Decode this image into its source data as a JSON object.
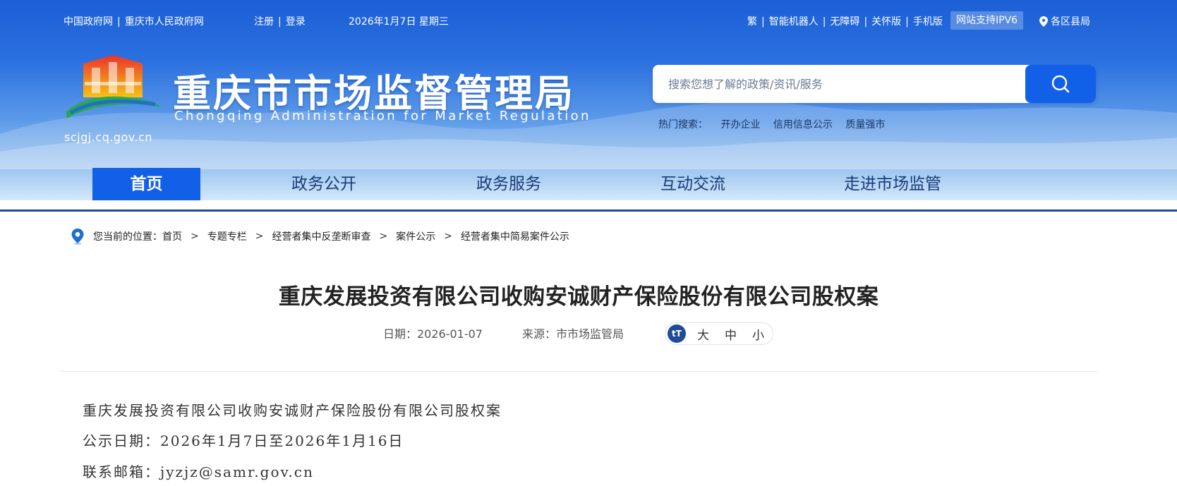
{
  "topbar": {
    "links": [
      "中国政府网",
      "重庆市人民政府网"
    ],
    "auth": [
      "注册",
      "登录"
    ],
    "date": "2026年1月7日 星期三",
    "tools": [
      "繁",
      "智能机器人",
      "无障碍",
      "关怀版",
      "手机版"
    ],
    "ipv6": "网站支持IPV6",
    "region": "各区县局"
  },
  "branding": {
    "title": "重庆市市场监督管理局",
    "subtitle": "Chongqing Administration for Market Regulation",
    "domain": "scjgj.cq.gov.cn"
  },
  "search": {
    "placeholder": "搜索您想了解的政策/资讯/服务",
    "hot_label": "热门搜索：",
    "hot_terms": [
      "开办企业",
      "信用信息公示",
      "质量强市"
    ]
  },
  "nav": [
    "首页",
    "政务公开",
    "政务服务",
    "互动交流",
    "走进市场监管"
  ],
  "breadcrumb": {
    "label": "您当前的位置：",
    "items": [
      "首页",
      "专题专栏",
      "经营者集中反垄断审查",
      "案件公示",
      "经营者集中简易案件公示"
    ],
    "separator": ">"
  },
  "article": {
    "title": "重庆发展投资有限公司收购安诚财产保险股份有限公司股权案",
    "date": "日期：2026-01-07",
    "source": "来源：市市场监管局",
    "font_icon": "tT",
    "font_sizes": [
      "大",
      "中",
      "小"
    ],
    "body": [
      "重庆发展投资有限公司收购安诚财产保险股份有限公司股权案",
      "公示日期：2026年1月7日至2026年1月16日",
      "联系邮箱：jyzjz@samr.gov.cn"
    ]
  },
  "icons": {
    "search": "search-icon",
    "location": "location-pin-icon",
    "font": "font-size-icon"
  },
  "colors": {
    "header_blue": "#1c5fd6",
    "nav_active": "#1260e8",
    "nav_accent_red": "#e5191c",
    "nav_text": "#1a3b78"
  }
}
